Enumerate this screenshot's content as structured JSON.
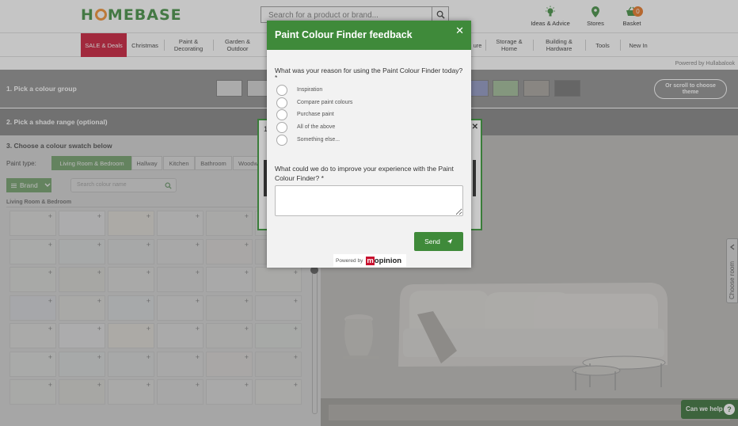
{
  "header": {
    "logo": "HOMEBASE",
    "search_placeholder": "Search for a product or brand...",
    "ideas_label": "Ideas & Advice",
    "stores_label": "Stores",
    "basket_label": "Basket",
    "basket_count": "0"
  },
  "nav": {
    "sale": "SALE & Deals",
    "christmas": "Christmas",
    "paint_1": "Paint &",
    "paint_2": "Decorating",
    "garden_1": "Garden &",
    "garden_2": "Outdoor",
    "furniture_partial": "ure",
    "storage_1": "Storage &",
    "storage_2": "Home",
    "building_1": "Building &",
    "building_2": "Hardware",
    "tools": "Tools",
    "new_in": "New In"
  },
  "hullabalook": "Powered by Hullabalook",
  "steps": {
    "step1": "1. Pick a colour group",
    "scroll_hint_1": "Or scroll to choose",
    "scroll_hint_2": "theme",
    "step2": "2. Pick a shade range (optional)",
    "step3": "3. Choose a colour swatch below",
    "paint_type_label": "Paint type:"
  },
  "colour_groups": [
    "#d8d8d8",
    "#cfcfcf",
    "#8a92c0",
    "#9cb893",
    "#a39e98",
    "#6e6e6e"
  ],
  "tabs": [
    "Living Room & Bedroom",
    "Hallway",
    "Kitchen",
    "Bathroom",
    "Woodw"
  ],
  "brand_label": "Brand",
  "colour_search_placeholder": "Search colour name",
  "swatch_section": "Living Room & Bedroom",
  "swatch_add": "+",
  "choose_room": "Choose room",
  "help": {
    "label": "Can we help",
    "icon": "?"
  },
  "modal": {
    "title": "Paint Colour Finder feedback",
    "close": "✕",
    "question1": "What was your reason for using the Paint Colour Finder today? *",
    "options": [
      "Inspiration",
      "Compare paint colours",
      "Purchase paint",
      "All of the above",
      "Something else..."
    ],
    "question2": "What could we do to improve your experience with the Paint Colour Finder? *",
    "textarea_value": "",
    "send_label": "Send",
    "powered_by": "Powered by",
    "brand_m": "m",
    "brand_rest": "opinion"
  },
  "background_dialog": {
    "prefix": "1",
    "close": "✕"
  }
}
